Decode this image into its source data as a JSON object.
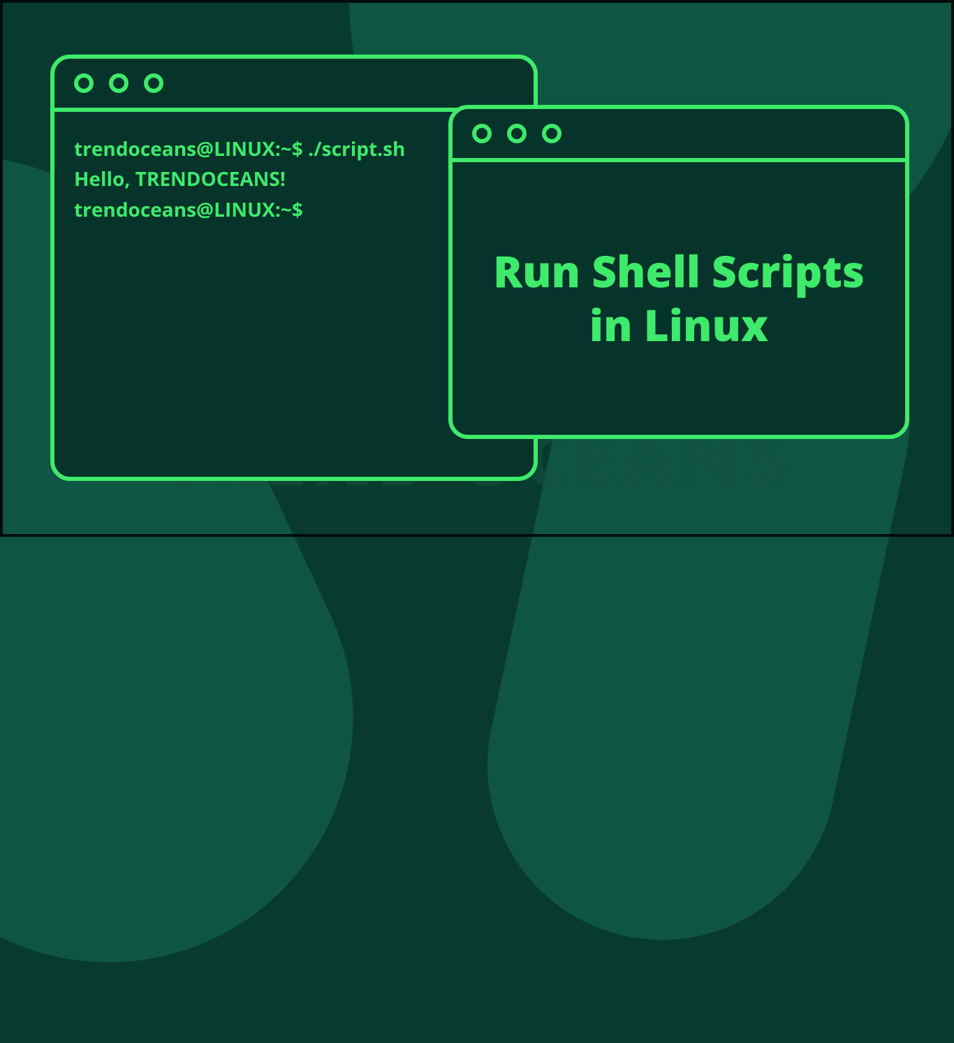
{
  "watermark": "TREND OCEANS",
  "terminal": {
    "line1": "trendoceans@LINUX:~$ ./script.sh",
    "line2": "Hello, TRENDOCEANS!",
    "line3": "trendoceans@LINUX:~$"
  },
  "card": {
    "title": "Run Shell Scripts in Linux"
  }
}
